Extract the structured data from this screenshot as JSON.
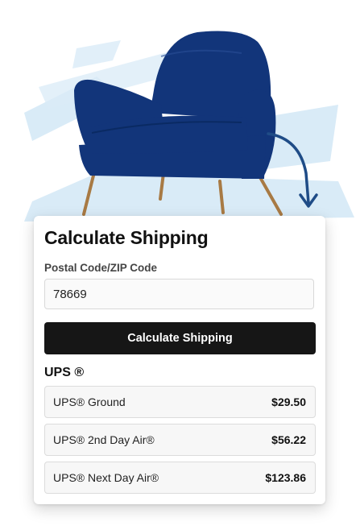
{
  "shipping": {
    "title": "Calculate Shipping",
    "postal_label": "Postal Code/ZIP Code",
    "postal_value": "78669",
    "button_label": "Calculate Shipping",
    "carrier": "UPS ®",
    "options": [
      {
        "name": "UPS® Ground",
        "price": "$29.50"
      },
      {
        "name": "UPS® 2nd Day Air®",
        "price": "$56.22"
      },
      {
        "name": "UPS® Next Day Air®",
        "price": "$123.86"
      }
    ]
  },
  "colors": {
    "chair": "#12357a",
    "splash": "#d9ebf7",
    "arrow": "#1f4c87",
    "button": "#161616"
  }
}
